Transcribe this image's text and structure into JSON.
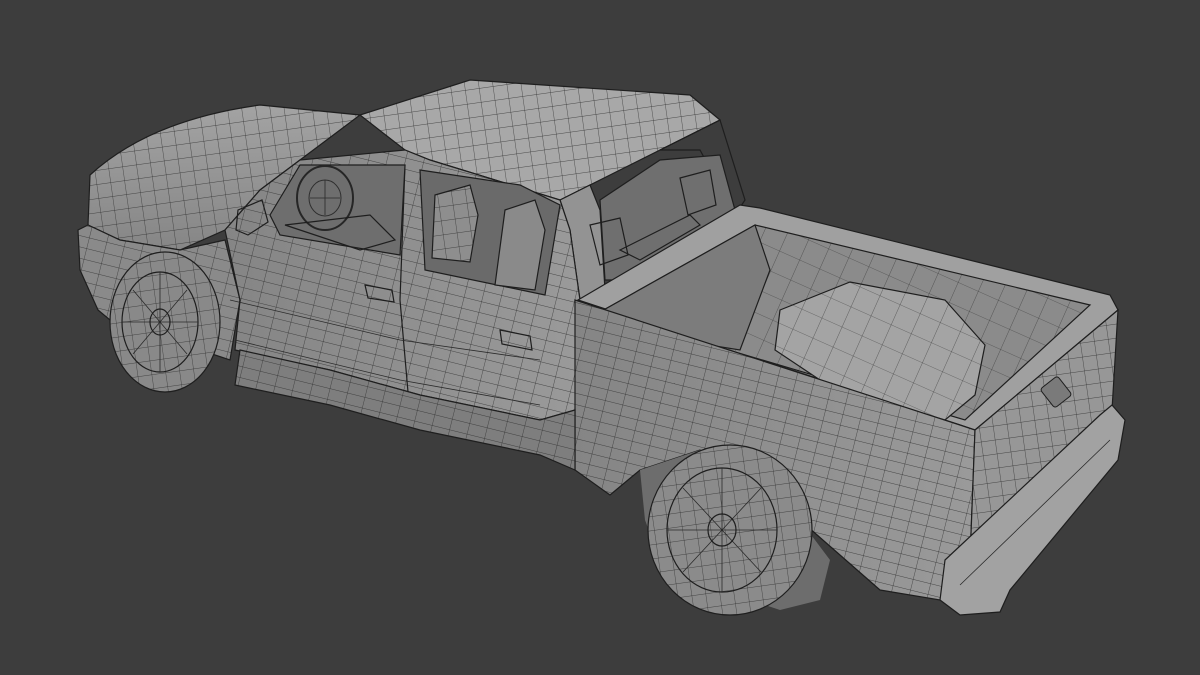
{
  "viewport": {
    "shading": "solid-wireframe",
    "background_color": "#3d3d3d",
    "surface_color": "#8d8d8d"
  },
  "scene": {
    "object": "pickup-truck-mesh"
  }
}
